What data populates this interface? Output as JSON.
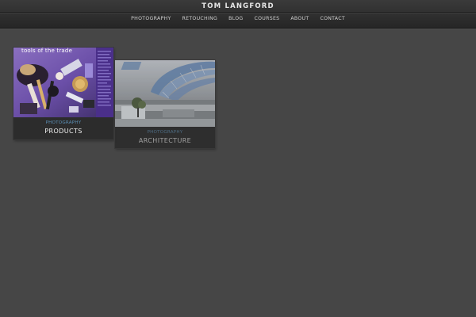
{
  "header": {
    "brand": "TOM LANGFORD",
    "nav": [
      "PHOTOGRAPHY",
      "RETOUCHING",
      "BLOG",
      "COURSES",
      "ABOUT",
      "CONTACT"
    ]
  },
  "portfolio": {
    "items": [
      {
        "category": "PHOTOGRAPHY",
        "title": "PRODUCTS",
        "image_text": "tools of the trade"
      },
      {
        "category": "PHOTOGRAPHY",
        "title": "ARCHITECTURE"
      }
    ]
  },
  "colors": {
    "background": "#464646",
    "topbar": "#262626",
    "category_accent": "#5b8fb5",
    "card": "#2c2c2c"
  }
}
